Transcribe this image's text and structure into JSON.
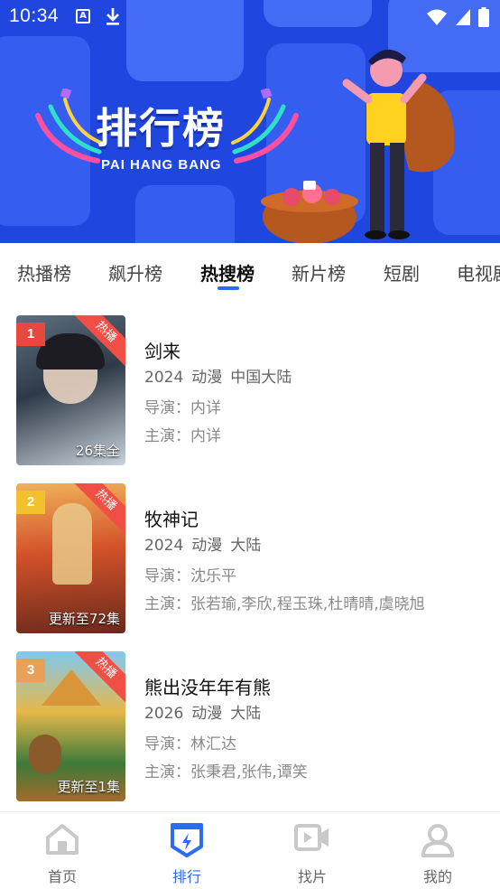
{
  "status_bar": {
    "time": "10:34",
    "a_icon": "A"
  },
  "banner": {
    "title": "排行榜",
    "subtitle": "PAI HANG BANG"
  },
  "tabs": [
    {
      "label": "热播榜",
      "active": false
    },
    {
      "label": "飙升榜",
      "active": false
    },
    {
      "label": "热搜榜",
      "active": true
    },
    {
      "label": "新片榜",
      "active": false
    },
    {
      "label": "短剧",
      "active": false
    },
    {
      "label": "电视剧",
      "active": false
    }
  ],
  "items": [
    {
      "rank": "1",
      "badge": "热播",
      "episodes": "26集全",
      "title": "剑来",
      "year": "2024",
      "genre": "动漫",
      "region": "中国大陆",
      "director": "导演：内详",
      "cast": "主演：内详",
      "rank_color": "#e8493f"
    },
    {
      "rank": "2",
      "badge": "热播",
      "episodes": "更新至72集",
      "title": "牧神记",
      "year": "2024",
      "genre": "动漫",
      "region": "大陆",
      "director": "导演：沈乐平",
      "cast": "主演：张若瑜,李欣,程玉珠,杜晴晴,虞晓旭",
      "rank_color": "#f2c12e"
    },
    {
      "rank": "3",
      "badge": "热播",
      "episodes": "更新至1集",
      "title": "熊出没年年有熊",
      "year": "2026",
      "genre": "动漫",
      "region": "大陆",
      "director": "导演：林汇达",
      "cast": "主演：张秉君,张伟,谭笑",
      "rank_color": "#e9a15a"
    }
  ],
  "bottom_nav": [
    {
      "label": "首页",
      "icon": "home-icon",
      "active": false
    },
    {
      "label": "排行",
      "icon": "ranking-icon",
      "active": true
    },
    {
      "label": "找片",
      "icon": "video-camera-icon",
      "active": false
    },
    {
      "label": "我的",
      "icon": "user-icon",
      "active": false
    }
  ],
  "colors": {
    "accent": "#2e6bf5",
    "banner": "#1f47e0",
    "hot": "#ef4f45"
  }
}
